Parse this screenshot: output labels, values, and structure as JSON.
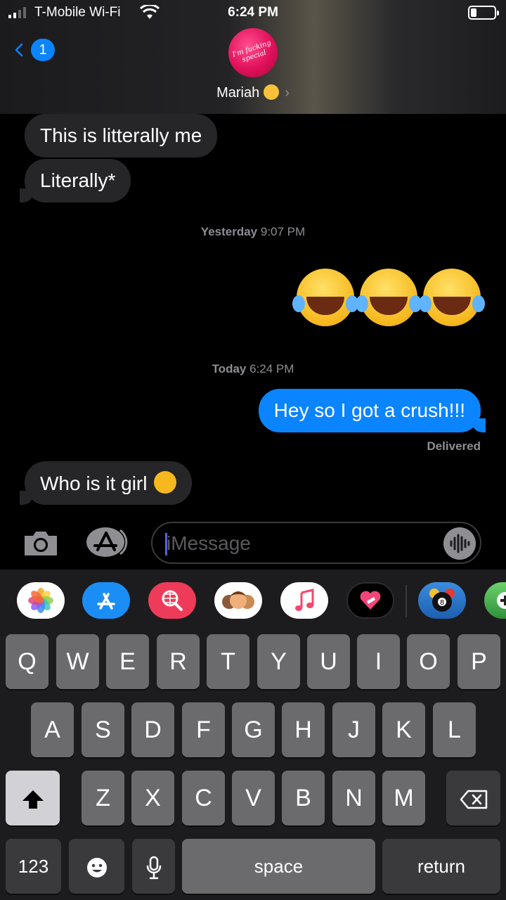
{
  "status_bar": {
    "carrier": "T-Mobile Wi-Fi",
    "time": "6:24 PM"
  },
  "header": {
    "back_badge": "1",
    "avatar_text": "I'm fucking special",
    "contact_name": "Mariah"
  },
  "messages": [
    {
      "dir": "in",
      "text": "This is litterally me"
    },
    {
      "dir": "in",
      "text": "Literally*"
    },
    {
      "dir": "stamp",
      "day": "Yesterday",
      "time": "9:07 PM"
    },
    {
      "dir": "out",
      "text": "😂😂😂"
    },
    {
      "dir": "stamp",
      "day": "Today",
      "time": "6:24 PM"
    },
    {
      "dir": "out",
      "text": "Hey so I got a crush!!!"
    },
    {
      "dir": "in",
      "text": "Who is it girl"
    }
  ],
  "delivered_label": "Delivered",
  "input": {
    "placeholder": "iMessage"
  },
  "app_drawer": [
    {
      "name": "Photos",
      "icon": "photos-icon",
      "color": "#ffffff"
    },
    {
      "name": "App Store",
      "icon": "appstore-icon",
      "color": "#1b8ef5"
    },
    {
      "name": "Search Images",
      "icon": "web-search-icon",
      "color": "#ef3b5a"
    },
    {
      "name": "Memoji",
      "icon": "memoji-icon",
      "color": "#ffffff"
    },
    {
      "name": "Music",
      "icon": "music-icon",
      "color": "#ffffff"
    },
    {
      "name": "Digital Touch",
      "icon": "digital-touch-icon",
      "color": "#000000"
    },
    {
      "name": "8 Ball Pool",
      "icon": "8ball-icon",
      "color": "#2a7bd4"
    },
    {
      "name": "Game",
      "icon": "game-icon",
      "color": "#4caf50"
    }
  ],
  "keyboard": {
    "row1": [
      "Q",
      "W",
      "E",
      "R",
      "T",
      "Y",
      "U",
      "I",
      "O",
      "P"
    ],
    "row2": [
      "A",
      "S",
      "D",
      "F",
      "G",
      "H",
      "J",
      "K",
      "L"
    ],
    "row3": [
      "Z",
      "X",
      "C",
      "V",
      "B",
      "N",
      "M"
    ],
    "numbers": "123",
    "space": "space",
    "return": "return"
  }
}
